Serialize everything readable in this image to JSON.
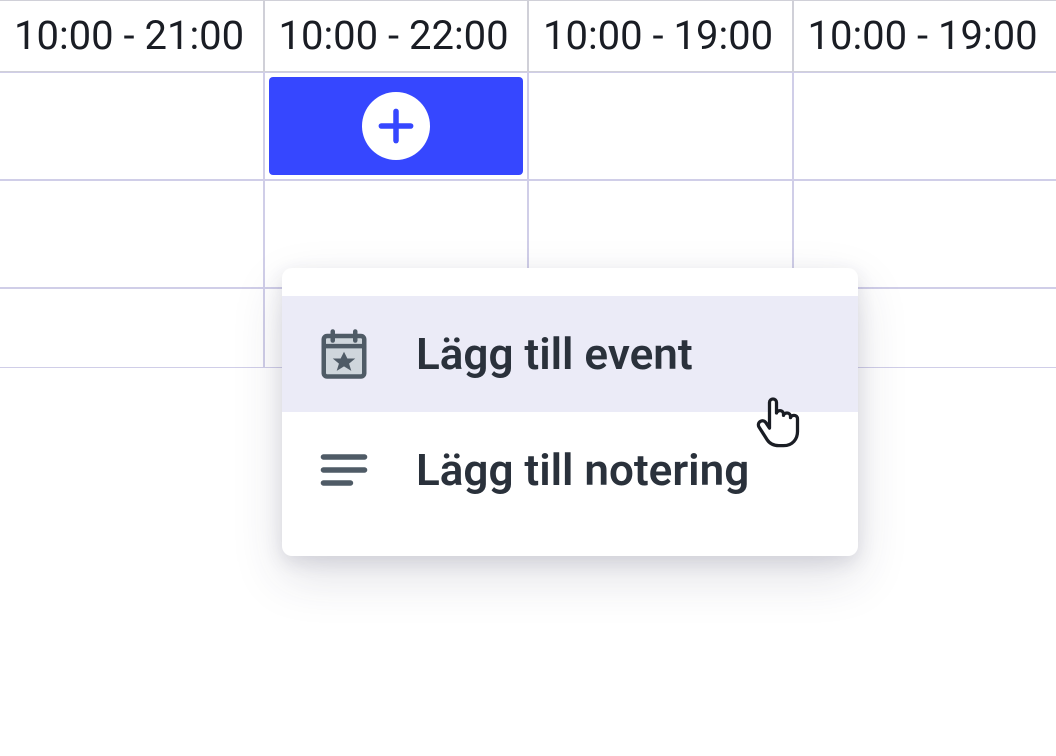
{
  "calendar": {
    "header_times": [
      "10:00 - 21:00",
      "10:00 - 22:00",
      "10:00 - 19:00",
      "10:00 - 19:00"
    ],
    "active_column": 1
  },
  "context_menu": {
    "items": [
      {
        "label": "Lägg till event",
        "highlighted": true,
        "icon": "calendar-star-icon"
      },
      {
        "label": "Lägg till notering",
        "highlighted": false,
        "icon": "notes-icon"
      }
    ]
  },
  "colors": {
    "accent": "#3647ff",
    "highlight_bg": "#ebebf7"
  }
}
